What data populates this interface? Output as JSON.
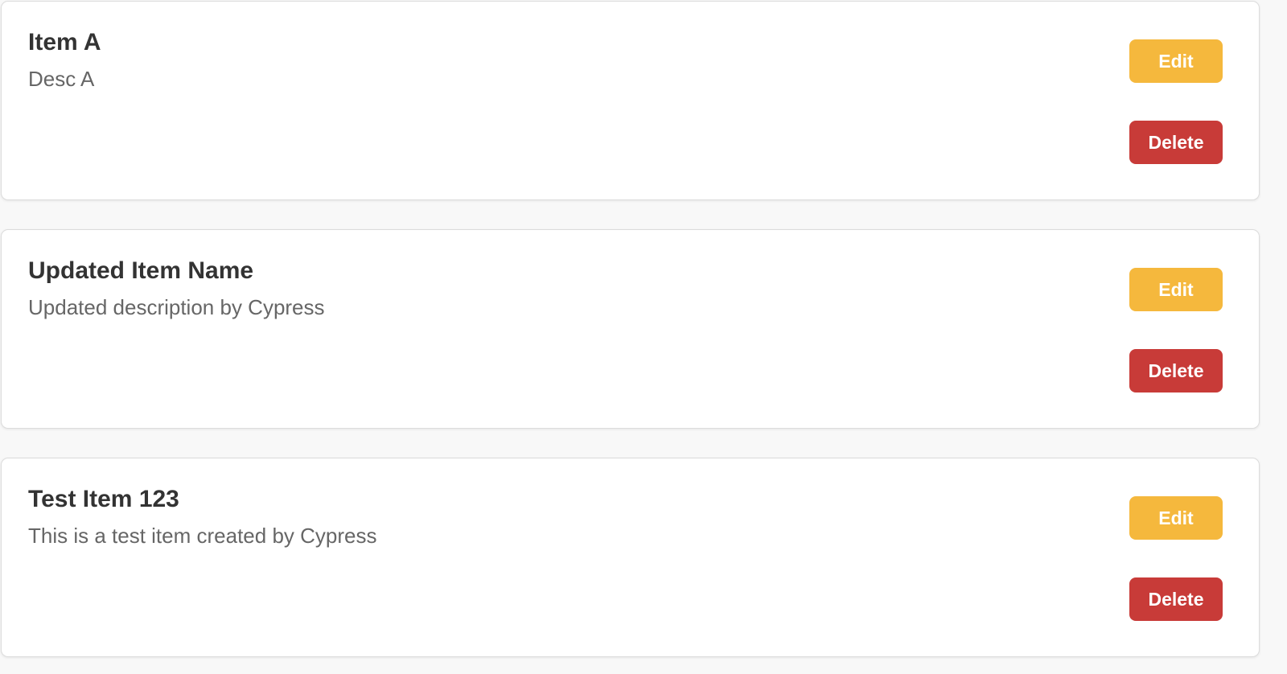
{
  "items": [
    {
      "name": "Item A",
      "description": "Desc A",
      "edit_label": "Edit",
      "delete_label": "Delete"
    },
    {
      "name": "Updated Item Name",
      "description": "Updated description by Cypress",
      "edit_label": "Edit",
      "delete_label": "Delete"
    },
    {
      "name": "Test Item 123",
      "description": "This is a test item created by Cypress",
      "edit_label": "Edit",
      "delete_label": "Delete"
    }
  ],
  "colors": {
    "edit_button": "#f5b83d",
    "delete_button": "#c83b38",
    "title_text": "#333333",
    "description_text": "#666666",
    "page_background": "#f8f8f8"
  }
}
